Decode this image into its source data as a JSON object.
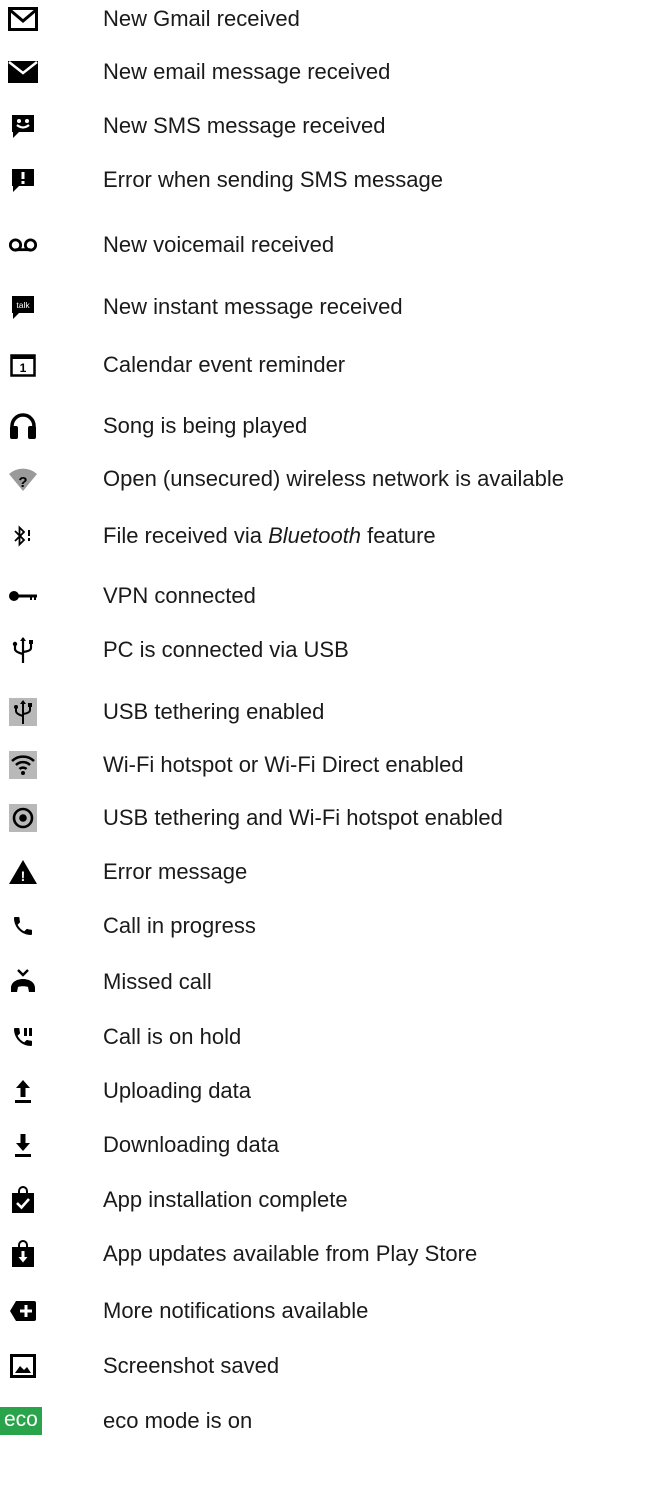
{
  "items": [
    {
      "icon": "gmail-envelope-icon",
      "label": "New Gmail received"
    },
    {
      "icon": "email-envelope-icon",
      "label": "New email message received"
    },
    {
      "icon": "sms-message-icon",
      "label": "New SMS message received"
    },
    {
      "icon": "sms-error-icon",
      "label": "Error when sending SMS message"
    },
    {
      "icon": "voicemail-icon",
      "label": "New voicemail received"
    },
    {
      "icon": "talk-instant-message-icon",
      "label": "New instant message received",
      "icon_text": "talk"
    },
    {
      "icon": "calendar-icon",
      "label": "Calendar event reminder",
      "icon_text": "1"
    },
    {
      "icon": "headphones-icon",
      "label": "Song is being played"
    },
    {
      "icon": "open-wifi-icon",
      "label": "Open (unsecured) wireless network is available",
      "icon_text": "?"
    },
    {
      "icon": "bluetooth-file-icon",
      "label_pre": "File received via ",
      "label_italic": "Bluetooth",
      "label_post": " feature"
    },
    {
      "icon": "vpn-key-icon",
      "label": "VPN connected"
    },
    {
      "icon": "usb-icon",
      "label": "PC is connected via USB"
    },
    {
      "icon": "usb-tethering-icon",
      "label": "USB tethering enabled"
    },
    {
      "icon": "wifi-hotspot-icon",
      "label": "Wi-Fi hotspot or Wi-Fi Direct enabled"
    },
    {
      "icon": "usb-wifi-hotspot-icon",
      "label": "USB tethering and Wi-Fi hotspot enabled"
    },
    {
      "icon": "warning-triangle-icon",
      "label": "Error message",
      "icon_text": "!"
    },
    {
      "icon": "phone-call-icon",
      "label": "Call in progress"
    },
    {
      "icon": "missed-call-icon",
      "label": "Missed call"
    },
    {
      "icon": "call-on-hold-icon",
      "label": "Call is on hold"
    },
    {
      "icon": "upload-arrow-icon",
      "label": "Uploading data"
    },
    {
      "icon": "download-arrow-icon",
      "label": "Downloading data"
    },
    {
      "icon": "app-install-complete-icon",
      "label": "App installation complete"
    },
    {
      "icon": "app-update-icon",
      "label": "App updates available from Play Store"
    },
    {
      "icon": "more-notifications-icon",
      "label": "More notifications available"
    },
    {
      "icon": "screenshot-icon",
      "label": "Screenshot saved"
    },
    {
      "icon": "eco-mode-icon",
      "label": "eco mode is on",
      "icon_text": "eco"
    }
  ],
  "colors": {
    "icon": "#000000",
    "usb_tether_bg": "#b8b8b8",
    "eco_green": "#2aa44a"
  }
}
